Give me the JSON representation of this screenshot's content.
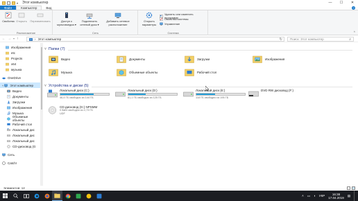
{
  "window": {
    "title": "Этот компьютер",
    "controls": {
      "minimize": "—",
      "maximize": "☐",
      "close": "✕"
    }
  },
  "ribbon": {
    "tabs": [
      {
        "label": "Файл"
      },
      {
        "label": "Компьютер"
      },
      {
        "label": "Вид"
      }
    ],
    "groups": {
      "location": {
        "label": "Расположение",
        "buttons": [
          "Свойства",
          "Открыть",
          "Переименовать"
        ]
      },
      "network": {
        "label": "Сеть",
        "buttons": [
          "Доступ к мультимедиа ▾",
          "Подключить сетевой диск ▾",
          "Добавить сетевое расположение"
        ]
      },
      "system": {
        "label": "Система",
        "big_button": "Открыть параметры",
        "small_buttons": [
          "Удалить или изменить программу",
          "Свойства системы",
          "Управление"
        ]
      }
    }
  },
  "address": {
    "path": "Этот компьютер",
    "search_placeholder": "Поиск: Этот компьютер"
  },
  "nav_pane": {
    "items": [
      {
        "label": "Изображения",
        "icon": "pictures-icon"
      },
      {
        "label": "etc",
        "icon": "folder-icon"
      },
      {
        "label": "Projects",
        "icon": "folder-icon"
      },
      {
        "label": "x64",
        "icon": "folder-icon"
      },
      {
        "label": "музыка",
        "icon": "folder-icon"
      },
      {
        "label": "OneDrive",
        "icon": "onedrive-icon"
      },
      {
        "label": "Этот компьютер",
        "icon": "computer-icon",
        "selected": true
      },
      {
        "label": "Видео",
        "icon": "videos-icon"
      },
      {
        "label": "Документы",
        "icon": "documents-icon"
      },
      {
        "label": "Загрузки",
        "icon": "downloads-icon"
      },
      {
        "label": "Изображения",
        "icon": "pictures-icon"
      },
      {
        "label": "Музыка",
        "icon": "music-icon"
      },
      {
        "label": "Объемные объекты",
        "icon": "3d-objects-icon"
      },
      {
        "label": "Рабочий стол",
        "icon": "desktop-icon"
      },
      {
        "label": "Локальный дис",
        "icon": "drive-icon"
      },
      {
        "label": "Локальный дис",
        "icon": "drive-icon"
      },
      {
        "label": "Локальный дис",
        "icon": "drive-icon"
      },
      {
        "label": "CD-дисковод (G",
        "icon": "cd-icon"
      },
      {
        "label": "Сеть",
        "icon": "network-icon"
      },
      {
        "label": "Catch!",
        "icon": "catch-icon"
      }
    ]
  },
  "folders_section": {
    "title": "Папки (7)",
    "folders": [
      {
        "label": "Видео",
        "icon": "videos-folder-icon"
      },
      {
        "label": "Документы",
        "icon": "documents-folder-icon"
      },
      {
        "label": "Загрузки",
        "icon": "downloads-folder-icon"
      },
      {
        "label": "Изображения",
        "icon": "pictures-folder-icon"
      },
      {
        "label": "Музыка",
        "icon": "music-folder-icon"
      },
      {
        "label": "Объемные объекты",
        "icon": "3d-objects-folder-icon"
      },
      {
        "label": "Рабочий стол",
        "icon": "desktop-folder-icon"
      }
    ]
  },
  "drives_section": {
    "title": "Устройства и диски (5)",
    "drives": [
      {
        "label": "Локальный диск (C:)",
        "free": "46,4 ГБ свободно из 144 ГБ",
        "used_fraction": 0.68
      },
      {
        "label": "Локальный диск (D:)",
        "free": "81,1 ГБ свободно из 125 ГБ",
        "used_fraction": 0.35
      },
      {
        "label": "Локальный диск (E:)",
        "free": "118 ГБ свободно из 195 ГБ",
        "used_fraction": 0.39
      },
      {
        "label": "DVD RW дисковод (F:)",
        "free": "",
        "used_fraction": null
      },
      {
        "label": "CD-дисковод (G:) NPSMM",
        "free": "0 байт свободно из 2,73 ГБ",
        "sub": "UDF",
        "used_fraction": null
      }
    ]
  },
  "status": {
    "items_count": "Элементов: 12"
  },
  "taskbar": {
    "tray": {
      "language": "УКР",
      "time": "16:38",
      "date": "17.04.2019"
    }
  },
  "colors": {
    "accent": "#1979ca",
    "selection": "#cce8ff",
    "drive_fill": "#26a0da",
    "section_title": "#1e3287",
    "taskbar": "#1b1d22"
  }
}
